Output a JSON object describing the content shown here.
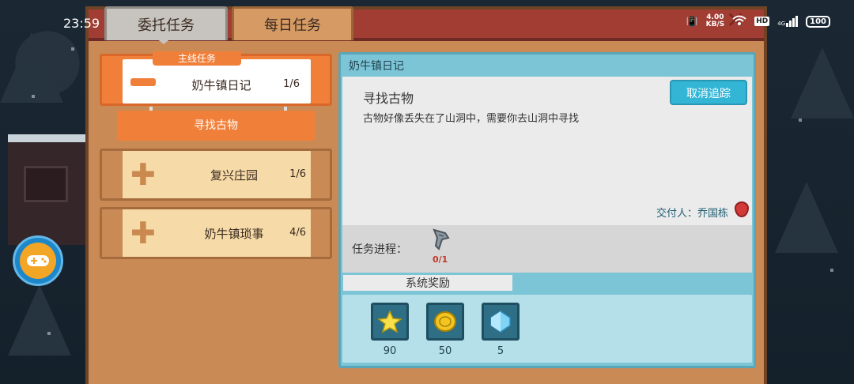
{
  "status_bar": {
    "time": "23:59",
    "speed_value": "4.00",
    "speed_unit": "KB/S",
    "hd": "HD",
    "network": "4G",
    "battery": "100"
  },
  "tabs": [
    {
      "label": "委托任务",
      "active": true
    },
    {
      "label": "每日任务",
      "active": false
    }
  ],
  "quest_list": {
    "main": {
      "tag": "主线任务",
      "name": "奶牛镇日记",
      "progress": "1/6",
      "sub_task": "寻找古物"
    },
    "items": [
      {
        "name": "复兴庄园",
        "progress": "1/6"
      },
      {
        "name": "奶牛镇琐事",
        "progress": "4/6"
      }
    ]
  },
  "detail": {
    "title": "奶牛镇日记",
    "task_name": "寻找古物",
    "task_desc": "古物好像丢失在了山洞中，需要你去山洞中寻找",
    "cancel_label": "取消追踪",
    "giver": "交付人：乔国栋",
    "progress_label": "任务进程：",
    "progress_count": "0/1",
    "reward_tab": "系统奖励",
    "rewards": [
      {
        "icon": "star-icon",
        "value": "90"
      },
      {
        "icon": "gold-coin-icon",
        "value": "50"
      },
      {
        "icon": "blue-gem-icon",
        "value": "5"
      }
    ]
  },
  "colors": {
    "accent_orange": "#f07f3a",
    "detail_blue": "#7cc5d6",
    "button_blue": "#33b6d6"
  }
}
